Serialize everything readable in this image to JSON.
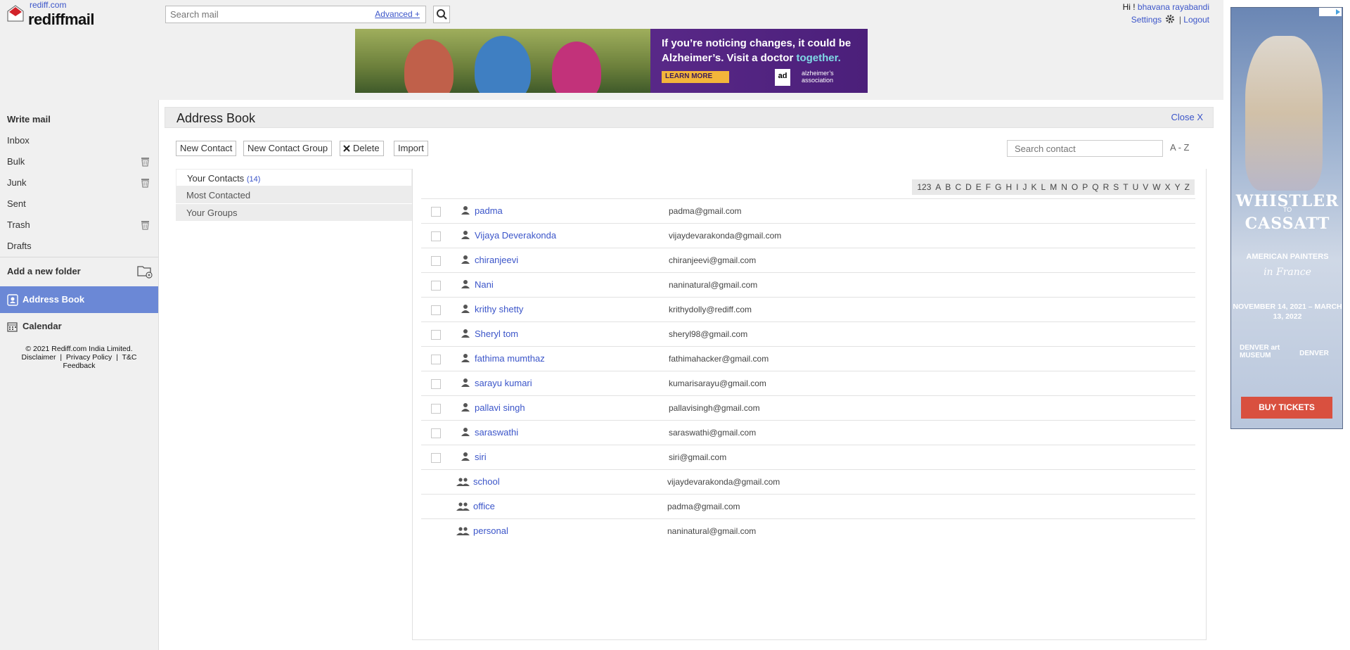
{
  "header": {
    "site_link": "rediff.com",
    "brand": "rediffmail",
    "search_placeholder": "Search mail",
    "advanced_link": "Advanced +",
    "greeting": "Hi !",
    "user_name": "bhavana rayabandi",
    "settings_label": "Settings",
    "logout_label": "Logout"
  },
  "top_ad": {
    "headline_1": "If you’re noticing changes, it could be",
    "headline_2": "Alzheimer’s. Visit a doctor",
    "headline_highlight": "together.",
    "cta": "LEARN MORE",
    "badge": "ad",
    "brand_1": "alzheimer’s",
    "brand_2": "association"
  },
  "sidebar": {
    "items": [
      {
        "label": "Write mail"
      },
      {
        "label": "Inbox"
      },
      {
        "label": "Bulk"
      },
      {
        "label": "Junk"
      },
      {
        "label": "Sent"
      },
      {
        "label": "Trash"
      },
      {
        "label": "Drafts"
      }
    ],
    "add_folder": "Add a new folder",
    "address_book": "Address Book",
    "calendar": "Calendar",
    "footer_copyright": "© 2021 Rediff.com India Limited.",
    "footer_disclaimer": "Disclaimer",
    "footer_privacy": "Privacy Policy",
    "footer_tc": "T&C",
    "footer_feedback": "Feedback"
  },
  "address_book": {
    "title": "Address Book",
    "close_label": "Close X",
    "toolbar": {
      "new_contact": "New Contact",
      "new_group": "New Contact Group",
      "delete": "Delete",
      "import": "Import",
      "search_placeholder": "Search contact",
      "sort_label": "A - Z"
    },
    "tabs": {
      "your_contacts": "Your Contacts",
      "your_contacts_count": "(14)",
      "most_contacted": "Most Contacted",
      "your_groups": "Your Groups"
    },
    "alphabet": [
      "123",
      "A",
      "B",
      "C",
      "D",
      "E",
      "F",
      "G",
      "H",
      "I",
      "J",
      "K",
      "L",
      "M",
      "N",
      "O",
      "P",
      "Q",
      "R",
      "S",
      "T",
      "U",
      "V",
      "W",
      "X",
      "Y",
      "Z"
    ],
    "contacts": [
      {
        "name": "padma",
        "email": "padma@gmail.com"
      },
      {
        "name": "Vijaya Deverakonda",
        "email": "vijaydevarakonda@gmail.com"
      },
      {
        "name": "chiranjeevi",
        "email": "chiranjeevi@gmail.com"
      },
      {
        "name": "Nani",
        "email": "naninatural@gmail.com"
      },
      {
        "name": "krithy shetty",
        "email": "krithydolly@rediff.com"
      },
      {
        "name": "Sheryl tom",
        "email": "sheryl98@gmail.com"
      },
      {
        "name": "fathima mumthaz",
        "email": "fathimahacker@gmail.com"
      },
      {
        "name": "sarayu kumari",
        "email": "kumarisarayu@gmail.com"
      },
      {
        "name": "pallavi singh",
        "email": "pallavisingh@gmail.com"
      },
      {
        "name": "saraswathi",
        "email": "saraswathi@gmail.com"
      },
      {
        "name": "siri",
        "email": "siri@gmail.com"
      }
    ],
    "groups": [
      {
        "name": "school",
        "email": "vijaydevarakonda@gmail.com"
      },
      {
        "name": "office",
        "email": "padma@gmail.com"
      },
      {
        "name": "personal",
        "email": "naninatural@gmail.com"
      }
    ]
  },
  "side_ad": {
    "line1": "WHISTLER",
    "line2": "TO",
    "line3": "CASSATT",
    "line4": "AMERICAN PAINTERS",
    "line5": "in France",
    "dates": "NOVEMBER 14, 2021 – MARCH 13, 2022",
    "museum": "DENVER art MUSEUM",
    "city": "DENVER",
    "cta": "BUY TICKETS"
  },
  "colors": {
    "link": "#3b55c9",
    "active_nav": "#6b88d6",
    "buy_button": "#d9503f"
  }
}
